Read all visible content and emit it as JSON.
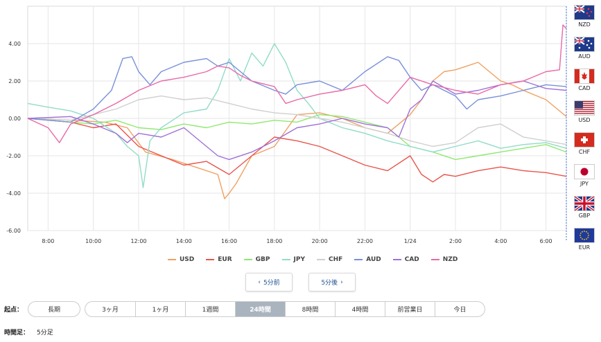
{
  "chart_data": {
    "type": "line",
    "y_ticks": [
      "4.00",
      "2.00",
      "0.00",
      "-2.00",
      "-4.00",
      "-6.00"
    ],
    "ylim": [
      -6,
      6
    ],
    "x_tick_labels": [
      "8:00",
      "10:00",
      "12:00",
      "14:00",
      "16:00",
      "18:00",
      "20:00",
      "22:00",
      "1/24",
      "2:00",
      "4:00",
      "6:00"
    ],
    "x_ticks_hours": [
      8,
      10,
      12,
      14,
      16,
      18,
      20,
      22,
      24,
      26,
      28,
      30
    ],
    "xlim_hours": [
      7.1,
      30.9
    ],
    "grid": true,
    "series": [
      {
        "name": "USD",
        "color": "#f0a060",
        "x": [
          7.1,
          9,
          10.5,
          11.5,
          12.3,
          13.5,
          14.5,
          15.5,
          15.8,
          16,
          16.3,
          17,
          18,
          19,
          20,
          21,
          22,
          23,
          24,
          24.5,
          25,
          25.5,
          26,
          26.5,
          27,
          28,
          28.5,
          29,
          30,
          30.5,
          30.9
        ],
        "values": [
          0,
          -0.1,
          -0.2,
          -0.5,
          -1.8,
          -2.2,
          -2.6,
          -3.0,
          -4.3,
          -4.0,
          -3.5,
          -2.0,
          -1.5,
          0.2,
          0.3,
          0.0,
          -0.5,
          -0.8,
          0.2,
          1.0,
          2.0,
          2.5,
          2.6,
          2.8,
          3.0,
          2.0,
          1.8,
          1.5,
          1.0,
          0.5,
          0.1
        ]
      },
      {
        "name": "EUR",
        "color": "#e8544a",
        "x": [
          7.1,
          9,
          10,
          11,
          12,
          13,
          14,
          15,
          16,
          17,
          18,
          19,
          20,
          21,
          22,
          23,
          24,
          24.5,
          25,
          25.5,
          26,
          27,
          28,
          29,
          30,
          30.9
        ],
        "values": [
          0,
          -0.2,
          -0.5,
          -0.3,
          -1.5,
          -2.0,
          -2.5,
          -2.3,
          -3.0,
          -2.0,
          -1.0,
          -1.2,
          -1.5,
          -2.0,
          -2.5,
          -2.8,
          -2.0,
          -3.0,
          -3.4,
          -3.0,
          -3.1,
          -2.8,
          -2.6,
          -2.8,
          -2.9,
          -3.1
        ]
      },
      {
        "name": "GBP",
        "color": "#8fe870",
        "x": [
          7.1,
          9,
          10,
          11,
          12,
          13,
          14,
          15,
          16,
          17,
          18,
          19,
          20,
          21,
          22,
          23,
          24,
          25,
          26,
          27,
          28,
          29,
          30,
          30.9
        ],
        "values": [
          0,
          -0.2,
          -0.3,
          -0.1,
          -0.5,
          -0.6,
          -0.3,
          -0.5,
          -0.2,
          -0.3,
          -0.1,
          -0.2,
          0.2,
          0.1,
          -0.2,
          -0.5,
          -1.5,
          -1.8,
          -2.2,
          -2.0,
          -1.8,
          -1.6,
          -1.4,
          -1.8
        ]
      },
      {
        "name": "JPY",
        "color": "#90dcc8",
        "x": [
          7.1,
          8,
          9,
          10,
          11,
          11.5,
          12,
          12.2,
          12.5,
          13,
          14,
          15,
          15.5,
          16,
          16.5,
          17,
          17.5,
          18,
          18.5,
          19,
          19.5,
          20,
          21,
          22,
          23,
          24,
          25,
          26,
          27,
          28,
          29,
          30,
          30.9
        ],
        "values": [
          0.8,
          0.6,
          0.4,
          0.0,
          -0.8,
          -1.5,
          -2.0,
          -3.7,
          -1.2,
          -0.5,
          0.3,
          0.5,
          1.5,
          3.2,
          2.0,
          3.5,
          2.8,
          4.0,
          3.0,
          1.5,
          0.8,
          0.0,
          -0.5,
          -0.8,
          -1.2,
          -1.5,
          -1.8,
          -1.5,
          -1.2,
          -1.6,
          -1.4,
          -1.3,
          -1.6
        ]
      },
      {
        "name": "CHF",
        "color": "#cfcfcf",
        "x": [
          7.1,
          9,
          10,
          11,
          12,
          13,
          14,
          15,
          16,
          17,
          18,
          19,
          20,
          21,
          22,
          23,
          24,
          25,
          26,
          27,
          28,
          29,
          30,
          30.9
        ],
        "values": [
          0,
          -0.1,
          0.2,
          0.5,
          1.0,
          1.2,
          1.0,
          1.1,
          0.8,
          0.5,
          0.3,
          0.2,
          0.0,
          -0.2,
          -0.5,
          -0.8,
          -1.2,
          -1.5,
          -1.3,
          -0.5,
          -0.3,
          -1.0,
          -1.2,
          -1.4
        ]
      },
      {
        "name": "AUD",
        "color": "#7890d8",
        "x": [
          7.1,
          9,
          10,
          10.8,
          11.3,
          11.7,
          12,
          12.5,
          13,
          14,
          15,
          15.5,
          16,
          16.5,
          17,
          18,
          18.5,
          19,
          20,
          21,
          22,
          23,
          23.5,
          24,
          24.5,
          25,
          26,
          26.5,
          27,
          28,
          29,
          30,
          30.9
        ],
        "values": [
          0,
          -0.2,
          0.5,
          1.5,
          3.2,
          3.3,
          2.5,
          1.8,
          2.5,
          3.0,
          3.2,
          2.8,
          3.0,
          2.5,
          2.0,
          1.5,
          1.3,
          1.8,
          2.0,
          1.5,
          2.5,
          3.3,
          3.1,
          2.2,
          1.5,
          1.8,
          1.2,
          0.5,
          1.0,
          1.2,
          1.5,
          1.8,
          1.7
        ]
      },
      {
        "name": "CAD",
        "color": "#a070d8",
        "x": [
          7.1,
          9,
          10,
          11,
          11.5,
          12,
          13,
          14,
          15,
          15.5,
          16,
          17,
          18,
          19,
          20,
          21,
          22,
          23,
          23.5,
          24,
          24.5,
          25,
          26,
          27,
          28,
          29,
          30,
          30.9
        ],
        "values": [
          0,
          0.1,
          -0.3,
          -0.8,
          -1.3,
          -0.8,
          -1.0,
          -0.5,
          -1.5,
          -2.0,
          -2.2,
          -1.8,
          -1.2,
          -0.5,
          -0.3,
          0.0,
          -0.3,
          -0.5,
          -1.0,
          0.5,
          1.0,
          2.0,
          1.3,
          1.5,
          1.8,
          2.0,
          1.6,
          1.5
        ]
      },
      {
        "name": "NZD",
        "color": "#e868a8",
        "x": [
          7.1,
          8,
          8.5,
          9,
          10,
          11,
          12,
          13,
          14,
          15,
          15.5,
          16,
          16.5,
          17,
          18,
          18.5,
          19,
          20,
          21,
          22,
          22.5,
          23,
          24,
          25,
          26,
          27,
          28,
          29,
          30,
          30.6,
          30.75,
          30.9
        ],
        "values": [
          0,
          -0.5,
          -1.3,
          -0.3,
          0.2,
          0.8,
          1.5,
          2.0,
          2.2,
          2.5,
          2.8,
          2.7,
          2.3,
          2.0,
          1.7,
          0.8,
          1.0,
          1.3,
          1.5,
          1.8,
          1.2,
          0.8,
          2.2,
          1.8,
          1.5,
          1.3,
          1.8,
          2.0,
          2.5,
          2.6,
          5.0,
          4.8
        ]
      }
    ]
  },
  "navigation": {
    "prev_label": "5分前",
    "next_label": "5分後"
  },
  "currency_flags": [
    {
      "code": "NZD",
      "icon": "nz-flag-icon"
    },
    {
      "code": "AUD",
      "icon": "au-flag-icon"
    },
    {
      "code": "CAD",
      "icon": "ca-flag-icon"
    },
    {
      "code": "USD",
      "icon": "us-flag-icon"
    },
    {
      "code": "CHF",
      "icon": "ch-flag-icon"
    },
    {
      "code": "JPY",
      "icon": "jp-flag-icon"
    },
    {
      "code": "GBP",
      "icon": "gb-flag-icon"
    },
    {
      "code": "EUR",
      "icon": "eu-flag-icon"
    }
  ],
  "controls": {
    "origin_label": "起点：",
    "long_term_label": "長期",
    "periods": [
      "3ヶ月",
      "1ヶ月",
      "1週間",
      "24時間",
      "8時間",
      "4時間",
      "前営業日",
      "今日"
    ],
    "active_period": "24時間",
    "timeframe_label": "時間足：",
    "timeframe_value": "5分足"
  }
}
